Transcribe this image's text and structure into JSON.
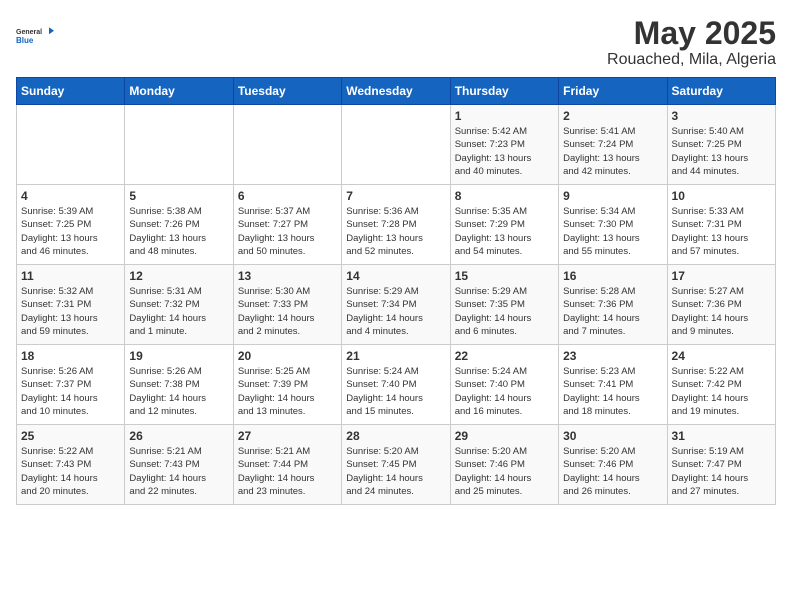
{
  "header": {
    "logo_line1": "General",
    "logo_line2": "Blue",
    "title": "May 2025",
    "subtitle": "Rouached, Mila, Algeria"
  },
  "weekdays": [
    "Sunday",
    "Monday",
    "Tuesday",
    "Wednesday",
    "Thursday",
    "Friday",
    "Saturday"
  ],
  "weeks": [
    [
      {
        "day": "",
        "info": ""
      },
      {
        "day": "",
        "info": ""
      },
      {
        "day": "",
        "info": ""
      },
      {
        "day": "",
        "info": ""
      },
      {
        "day": "1",
        "info": "Sunrise: 5:42 AM\nSunset: 7:23 PM\nDaylight: 13 hours\nand 40 minutes."
      },
      {
        "day": "2",
        "info": "Sunrise: 5:41 AM\nSunset: 7:24 PM\nDaylight: 13 hours\nand 42 minutes."
      },
      {
        "day": "3",
        "info": "Sunrise: 5:40 AM\nSunset: 7:25 PM\nDaylight: 13 hours\nand 44 minutes."
      }
    ],
    [
      {
        "day": "4",
        "info": "Sunrise: 5:39 AM\nSunset: 7:25 PM\nDaylight: 13 hours\nand 46 minutes."
      },
      {
        "day": "5",
        "info": "Sunrise: 5:38 AM\nSunset: 7:26 PM\nDaylight: 13 hours\nand 48 minutes."
      },
      {
        "day": "6",
        "info": "Sunrise: 5:37 AM\nSunset: 7:27 PM\nDaylight: 13 hours\nand 50 minutes."
      },
      {
        "day": "7",
        "info": "Sunrise: 5:36 AM\nSunset: 7:28 PM\nDaylight: 13 hours\nand 52 minutes."
      },
      {
        "day": "8",
        "info": "Sunrise: 5:35 AM\nSunset: 7:29 PM\nDaylight: 13 hours\nand 54 minutes."
      },
      {
        "day": "9",
        "info": "Sunrise: 5:34 AM\nSunset: 7:30 PM\nDaylight: 13 hours\nand 55 minutes."
      },
      {
        "day": "10",
        "info": "Sunrise: 5:33 AM\nSunset: 7:31 PM\nDaylight: 13 hours\nand 57 minutes."
      }
    ],
    [
      {
        "day": "11",
        "info": "Sunrise: 5:32 AM\nSunset: 7:31 PM\nDaylight: 13 hours\nand 59 minutes."
      },
      {
        "day": "12",
        "info": "Sunrise: 5:31 AM\nSunset: 7:32 PM\nDaylight: 14 hours\nand 1 minute."
      },
      {
        "day": "13",
        "info": "Sunrise: 5:30 AM\nSunset: 7:33 PM\nDaylight: 14 hours\nand 2 minutes."
      },
      {
        "day": "14",
        "info": "Sunrise: 5:29 AM\nSunset: 7:34 PM\nDaylight: 14 hours\nand 4 minutes."
      },
      {
        "day": "15",
        "info": "Sunrise: 5:29 AM\nSunset: 7:35 PM\nDaylight: 14 hours\nand 6 minutes."
      },
      {
        "day": "16",
        "info": "Sunrise: 5:28 AM\nSunset: 7:36 PM\nDaylight: 14 hours\nand 7 minutes."
      },
      {
        "day": "17",
        "info": "Sunrise: 5:27 AM\nSunset: 7:36 PM\nDaylight: 14 hours\nand 9 minutes."
      }
    ],
    [
      {
        "day": "18",
        "info": "Sunrise: 5:26 AM\nSunset: 7:37 PM\nDaylight: 14 hours\nand 10 minutes."
      },
      {
        "day": "19",
        "info": "Sunrise: 5:26 AM\nSunset: 7:38 PM\nDaylight: 14 hours\nand 12 minutes."
      },
      {
        "day": "20",
        "info": "Sunrise: 5:25 AM\nSunset: 7:39 PM\nDaylight: 14 hours\nand 13 minutes."
      },
      {
        "day": "21",
        "info": "Sunrise: 5:24 AM\nSunset: 7:40 PM\nDaylight: 14 hours\nand 15 minutes."
      },
      {
        "day": "22",
        "info": "Sunrise: 5:24 AM\nSunset: 7:40 PM\nDaylight: 14 hours\nand 16 minutes."
      },
      {
        "day": "23",
        "info": "Sunrise: 5:23 AM\nSunset: 7:41 PM\nDaylight: 14 hours\nand 18 minutes."
      },
      {
        "day": "24",
        "info": "Sunrise: 5:22 AM\nSunset: 7:42 PM\nDaylight: 14 hours\nand 19 minutes."
      }
    ],
    [
      {
        "day": "25",
        "info": "Sunrise: 5:22 AM\nSunset: 7:43 PM\nDaylight: 14 hours\nand 20 minutes."
      },
      {
        "day": "26",
        "info": "Sunrise: 5:21 AM\nSunset: 7:43 PM\nDaylight: 14 hours\nand 22 minutes."
      },
      {
        "day": "27",
        "info": "Sunrise: 5:21 AM\nSunset: 7:44 PM\nDaylight: 14 hours\nand 23 minutes."
      },
      {
        "day": "28",
        "info": "Sunrise: 5:20 AM\nSunset: 7:45 PM\nDaylight: 14 hours\nand 24 minutes."
      },
      {
        "day": "29",
        "info": "Sunrise: 5:20 AM\nSunset: 7:46 PM\nDaylight: 14 hours\nand 25 minutes."
      },
      {
        "day": "30",
        "info": "Sunrise: 5:20 AM\nSunset: 7:46 PM\nDaylight: 14 hours\nand 26 minutes."
      },
      {
        "day": "31",
        "info": "Sunrise: 5:19 AM\nSunset: 7:47 PM\nDaylight: 14 hours\nand 27 minutes."
      }
    ]
  ]
}
